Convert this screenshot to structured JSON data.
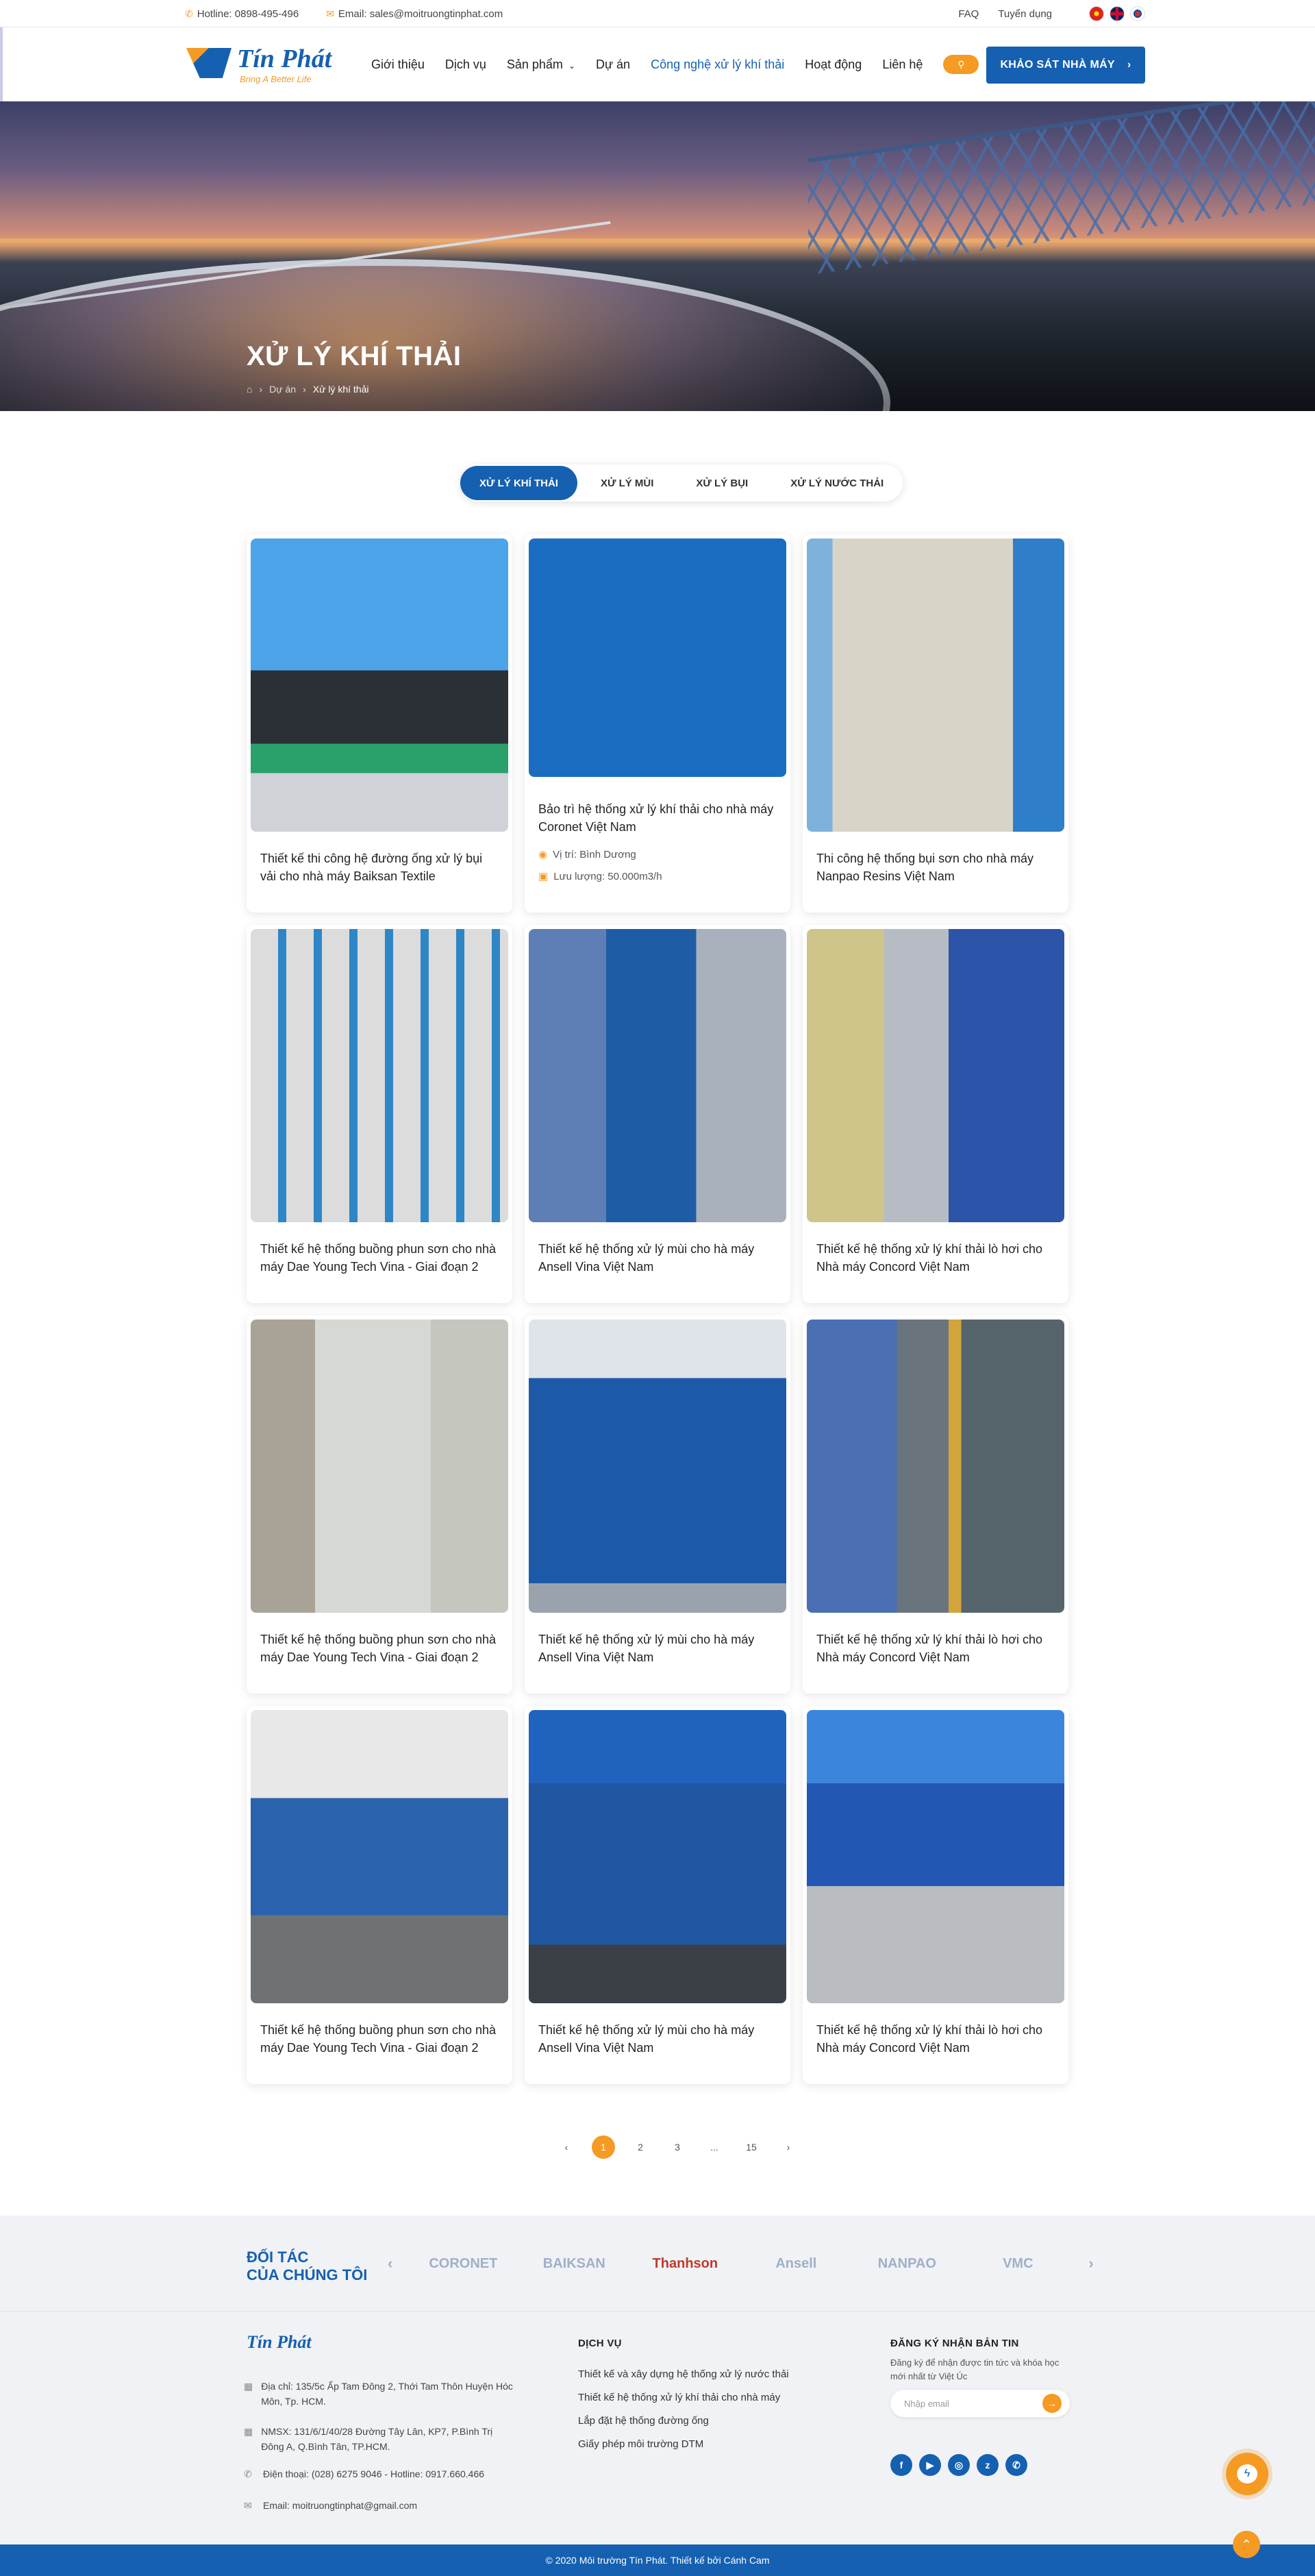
{
  "topbar": {
    "hotline": "Hotline: 0898-495-496",
    "email": "Email: sales@moitruongtinphat.com",
    "faq": "FAQ",
    "careers": "Tuyển dụng"
  },
  "logo": {
    "name": "Tín Phát",
    "slogan": "Bring A Better Life"
  },
  "nav": {
    "items": [
      "Giới thiệu",
      "Dịch vụ",
      "Sản phẩm",
      "Dự án",
      "Công nghệ xử lý khí thải",
      "Hoạt động",
      "Liên hệ"
    ],
    "cta": "KHẢO SÁT NHÀ MÁY"
  },
  "hero": {
    "title": "XỬ LÝ KHÍ THẢI",
    "breadcrumb": [
      "Dự án",
      "Xử lý khí thải"
    ]
  },
  "tabs": [
    "XỬ LÝ KHÍ THẢI",
    "XỬ LÝ MÙI",
    "XỬ LÝ BỤI",
    "XỬ LÝ NƯỚC THẢI"
  ],
  "projects": [
    {
      "title": "Thiết kế thi công hệ đường ống xử lý bụi vải cho nhà máy Baiksan Textile"
    },
    {
      "title": "Bảo trì hệ thống xử lý khí thải cho nhà máy Coronet Việt Nam",
      "location": "Vị trí: Bình Dương",
      "capacity": "Lưu lượng: 50.000m3/h"
    },
    {
      "title": "Thi công hệ thống bụi sơn cho nhà máy Nanpao Resins Việt Nam"
    },
    {
      "title": "Thiết kế hệ thống buồng phun sơn cho nhà máy Dae Young Tech Vina - Giai đoạn 2"
    },
    {
      "title": "Thiết kế hệ thống xử lý mùi cho hà máy Ansell Vina Việt Nam"
    },
    {
      "title": "Thiết kế hệ thống xử lý khí thải lò hơi cho Nhà máy Concord Việt Nam"
    },
    {
      "title": "Thiết kế hệ thống buồng phun sơn cho nhà máy Dae Young Tech Vina - Giai đoạn 2"
    },
    {
      "title": "Thiết kế hệ thống xử lý mùi cho hà máy Ansell Vina Việt Nam"
    },
    {
      "title": "Thiết kế hệ thống xử lý khí thải lò hơi cho Nhà máy Concord Việt Nam"
    },
    {
      "title": "Thiết kế hệ thống buồng phun sơn cho nhà máy Dae Young Tech Vina - Giai đoạn 2"
    },
    {
      "title": "Thiết kế hệ thống xử lý mùi cho hà máy Ansell Vina Việt Nam"
    },
    {
      "title": "Thiết kế hệ thống xử lý khí thải lò hơi cho Nhà máy Concord Việt Nam"
    }
  ],
  "pagination": {
    "pages": [
      "1",
      "2",
      "3",
      "...",
      "15"
    ],
    "current": "1"
  },
  "partners": {
    "title_line1": "ĐỐI TÁC",
    "title_line2": "CỦA CHÚNG TÔI",
    "logos": [
      "CORONET",
      "BAIKSAN",
      "Thanhson",
      "Ansell",
      "NANPAO",
      "VMC"
    ]
  },
  "footer": {
    "address": "Địa chỉ: 135/5c Ấp Tam Đông 2, Thới Tam Thôn Huyện Hóc Môn, Tp. HCM.",
    "factory": "NMSX: 131/6/1/40/28 Đường Tây Lân, KP7, P.Bình Trị Đông A, Q.Bình Tân, TP.HCM.",
    "phone": "Điện thoại: (028) 6275 9046 - Hotline: 0917.660.466",
    "email": "Email: moitruongtinphat@gmail.com",
    "services_title": "DỊCH VỤ",
    "services": [
      "Thiết kế và xây dựng hệ thống xử lý nước thải",
      "Thiết kế hệ thống xử lý khí thải cho nhà máy",
      "Lắp đặt hệ thống đường ống",
      "Giấy phép môi trường DTM"
    ],
    "newsletter_title": "ĐĂNG KÝ NHẬN BẢN TIN",
    "newsletter_desc": "Đăng ký để nhận được tin tức và khóa học mới nhất từ Việt Úc",
    "newsletter_placeholder": "Nhập email"
  },
  "copyright": "© 2020 Môi trường Tín Phát. Thiết kế bởi Cánh Cam",
  "colors": {
    "brand_blue": "#1560b0",
    "accent_orange": "#f59a23"
  }
}
